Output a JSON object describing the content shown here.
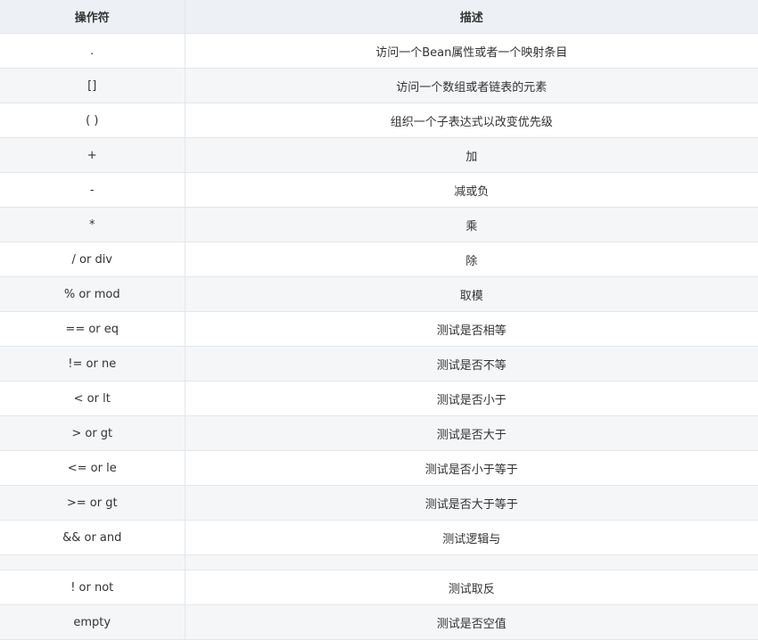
{
  "table": {
    "headers": [
      "操作符",
      "描述"
    ],
    "rows": [
      {
        "op": ".",
        "desc": "访问一个Bean属性或者一个映射条目"
      },
      {
        "op": "[]",
        "desc": "访问一个数组或者链表的元素"
      },
      {
        "op": "( )",
        "desc": "组织一个子表达式以改变优先级"
      },
      {
        "op": "+",
        "desc": "加"
      },
      {
        "op": "-",
        "desc": "减或负"
      },
      {
        "op": "*",
        "desc": "乘"
      },
      {
        "op": "/ or div",
        "desc": "除"
      },
      {
        "op": "% or mod",
        "desc": "取模"
      },
      {
        "op": "== or eq",
        "desc": "测试是否相等"
      },
      {
        "op": "!= or ne",
        "desc": "测试是否不等"
      },
      {
        "op": "< or lt",
        "desc": "测试是否小于"
      },
      {
        "op": "> or gt",
        "desc": "测试是否大于"
      },
      {
        "op": "<= or le",
        "desc": "测试是否小于等于"
      },
      {
        "op": ">= or gt",
        "desc": "测试是否大于等于"
      },
      {
        "op": "&& or and",
        "desc": "测试逻辑与"
      },
      {
        "op": "",
        "desc": ""
      },
      {
        "op": "! or not",
        "desc": "测试取反"
      },
      {
        "op": "empty",
        "desc": "测试是否空值"
      }
    ]
  }
}
